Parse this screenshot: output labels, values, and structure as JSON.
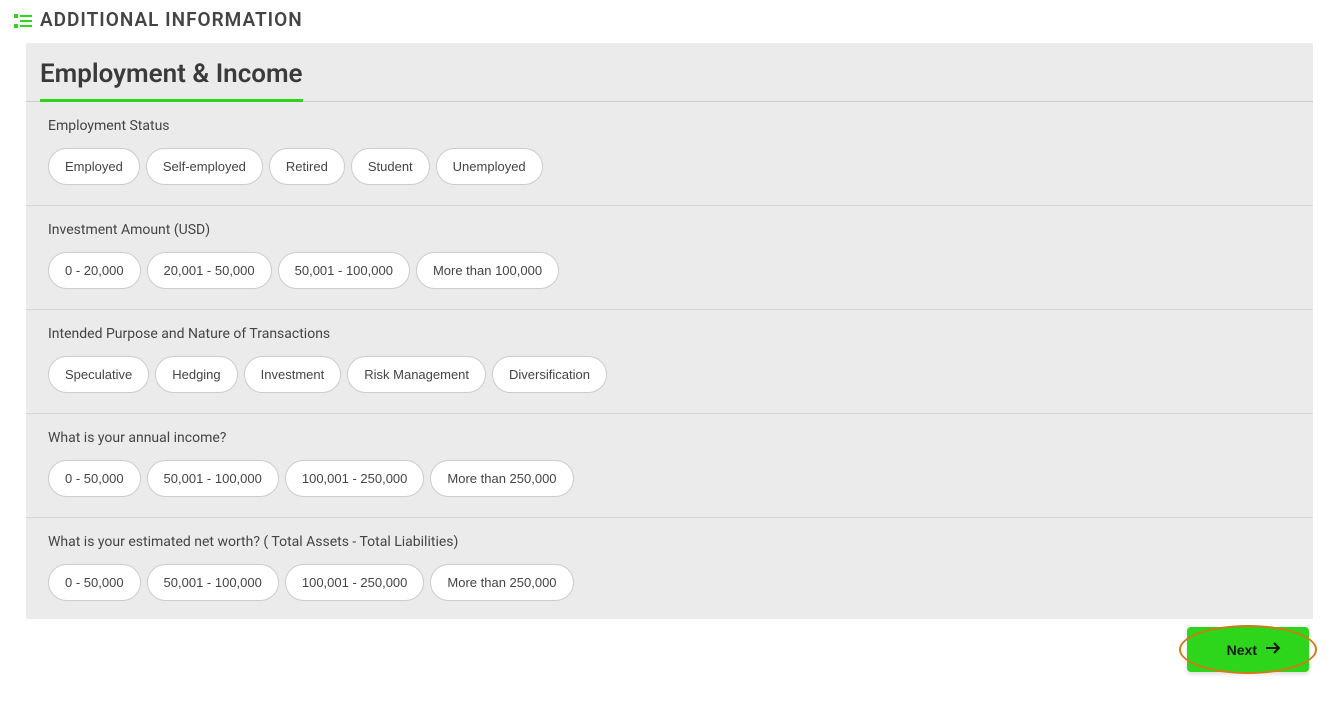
{
  "header": {
    "title": "ADDITIONAL INFORMATION"
  },
  "card": {
    "title": "Employment & Income",
    "sections": [
      {
        "label": "Employment Status",
        "options": [
          "Employed",
          "Self-employed",
          "Retired",
          "Student",
          "Unemployed"
        ]
      },
      {
        "label": "Investment Amount (USD)",
        "options": [
          "0 - 20,000",
          "20,001 - 50,000",
          "50,001 - 100,000",
          "More than 100,000"
        ]
      },
      {
        "label": "Intended Purpose and Nature of Transactions",
        "options": [
          "Speculative",
          "Hedging",
          "Investment",
          "Risk Management",
          "Diversification"
        ]
      },
      {
        "label": "What is your annual income?",
        "options": [
          "0 - 50,000",
          "50,001 - 100,000",
          "100,001 - 250,000",
          "More than 250,000"
        ]
      },
      {
        "label": "What is your estimated net worth? ( Total Assets - Total Liabilities)",
        "options": [
          "0 - 50,000",
          "50,001 - 100,000",
          "100,001 - 250,000",
          "More than 250,000"
        ]
      }
    ]
  },
  "footer": {
    "next_label": "Next"
  },
  "colors": {
    "accent": "#2dd51b",
    "highlight_ring": "#d17a1b"
  }
}
